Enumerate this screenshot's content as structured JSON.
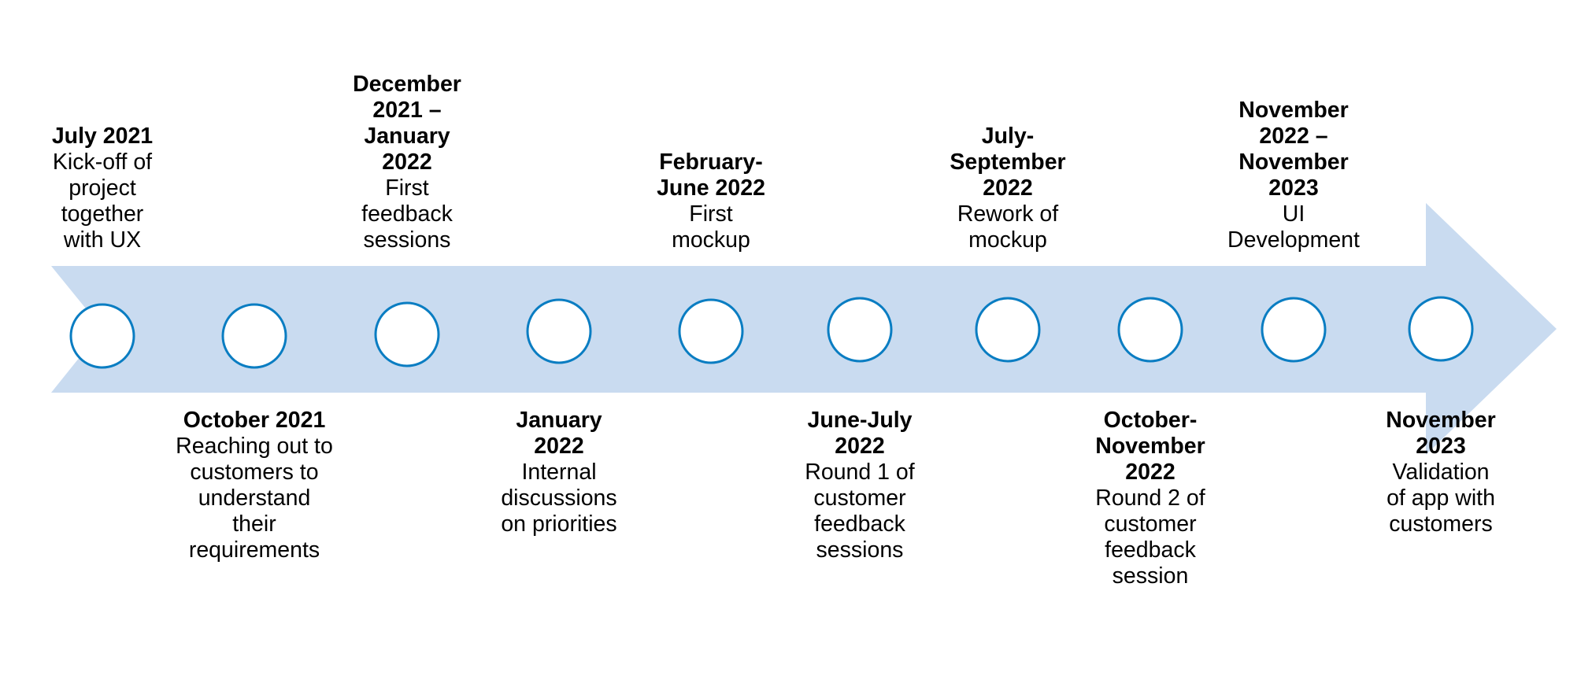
{
  "diagram": {
    "type": "timeline",
    "colors": {
      "band": "#C9DBF0",
      "milestone_stroke": "#0A7DC2",
      "milestone_fill": "#FFFFFF",
      "text": "#000000"
    },
    "milestones": [
      {
        "position": "top",
        "date": "July 2021",
        "description": "Kick-off of\nproject\ntogether\nwith UX"
      },
      {
        "position": "bottom",
        "date": "October 2021",
        "description": "Reaching out to\ncustomers to\nunderstand\ntheir\nrequirements"
      },
      {
        "position": "top",
        "date": "December\n2021 –\nJanuary\n2022",
        "description": "First\nfeedback\nsessions"
      },
      {
        "position": "bottom",
        "date": "January\n2022",
        "description": "Internal\ndiscussions\non priorities"
      },
      {
        "position": "top",
        "date": "February-\nJune 2022",
        "description": "First\nmockup"
      },
      {
        "position": "bottom",
        "date": "June-July\n2022",
        "description": "Round 1 of\ncustomer\nfeedback\nsessions"
      },
      {
        "position": "top",
        "date": "July-\nSeptember\n2022",
        "description": "Rework of\nmockup"
      },
      {
        "position": "bottom",
        "date": "October-\nNovember\n2022",
        "description": "Round 2 of\ncustomer\nfeedback\nsession"
      },
      {
        "position": "top",
        "date": "November\n2022 –\nNovember\n2023",
        "description": "UI\nDevelopment"
      },
      {
        "position": "bottom",
        "date": "November\n2023",
        "description": "Validation\nof app with\ncustomers"
      }
    ]
  }
}
